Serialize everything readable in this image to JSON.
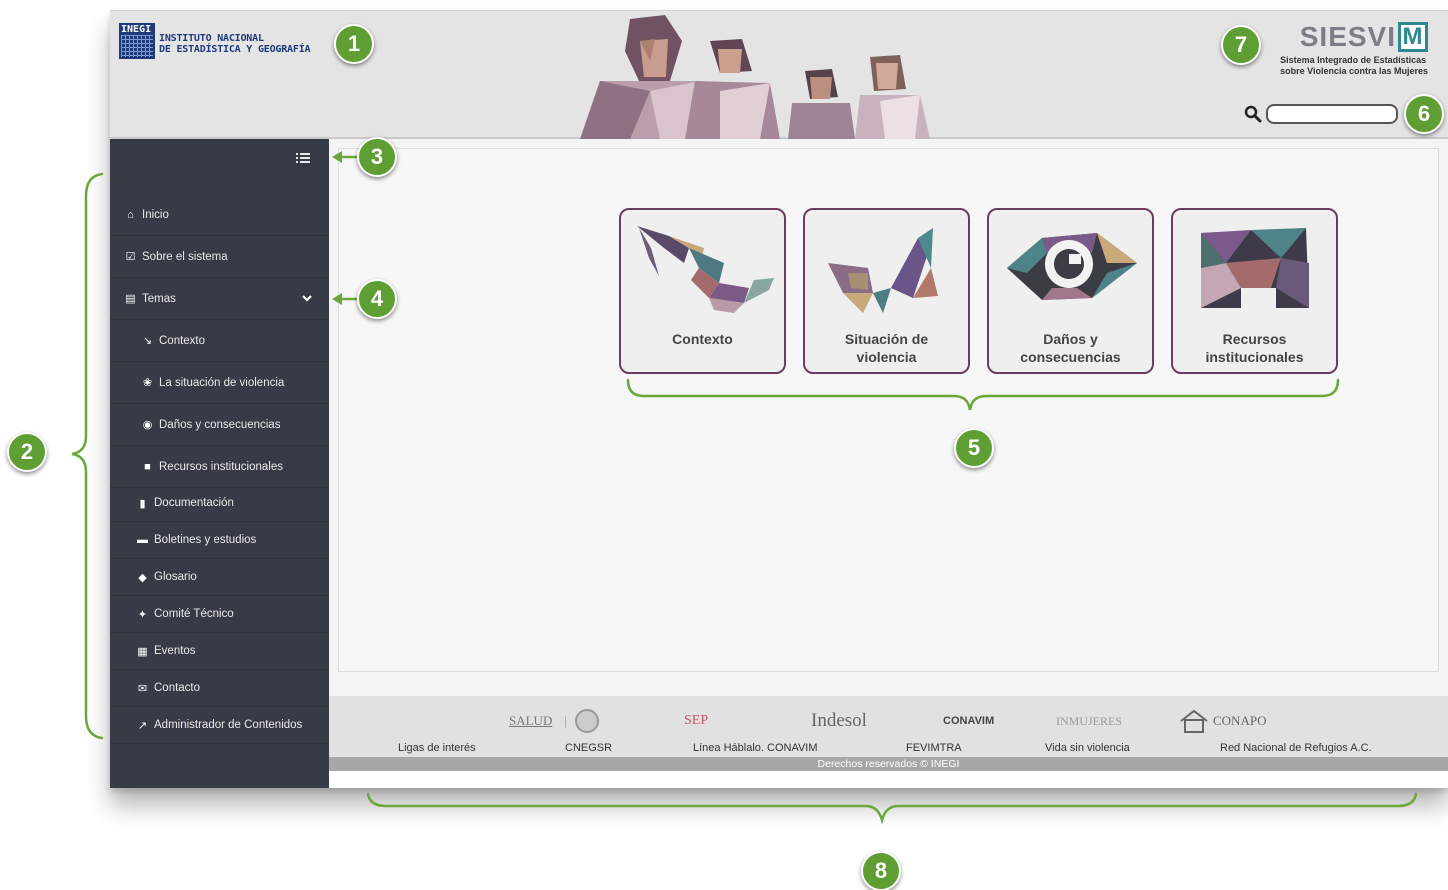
{
  "header": {
    "inegi_box": "INEGI",
    "inegi_line1": "INSTITUTO NACIONAL",
    "inegi_line2": "DE ESTADÍSTICA Y GEOGRAFÍA",
    "siesvim_word": "SIESVI",
    "siesvim_m": "M",
    "siesvim_sub1": "Sistema Integrado de Estadísticas",
    "siesvim_sub2": "sobre Violencia contra las Mujeres",
    "search_value": ""
  },
  "sidebar": {
    "items": [
      {
        "icon": "home-icon",
        "glyph": "⌂",
        "label": "Inicio"
      },
      {
        "icon": "checkbox-icon",
        "glyph": "☑",
        "label": "Sobre el sistema"
      },
      {
        "icon": "monitor-icon",
        "glyph": "▤",
        "label": "Temas"
      },
      {
        "icon": "map-icon",
        "glyph": "↘",
        "label": "Contexto"
      },
      {
        "icon": "butterfly-icon",
        "glyph": "❀",
        "label": "La situación de violencia"
      },
      {
        "icon": "eye-icon",
        "glyph": "◉",
        "label": "Daños y consecuencias"
      },
      {
        "icon": "building-icon",
        "glyph": "■",
        "label": "Recursos institucionales"
      },
      {
        "icon": "document-icon",
        "glyph": "▮",
        "label": "Documentación"
      },
      {
        "icon": "newspaper-icon",
        "glyph": "▬",
        "label": "Boletines y estudios"
      },
      {
        "icon": "book-icon",
        "glyph": "◆",
        "label": "Glosario"
      },
      {
        "icon": "users-icon",
        "glyph": "✦",
        "label": "Comité Técnico"
      },
      {
        "icon": "calendar-icon",
        "glyph": "▦",
        "label": "Eventos"
      },
      {
        "icon": "envelope-icon",
        "glyph": "✉",
        "label": "Contacto"
      },
      {
        "icon": "wrench-icon",
        "glyph": "↗",
        "label": "Administrador de Contenidos"
      }
    ]
  },
  "cards": [
    {
      "line1": "Contexto",
      "line2": ""
    },
    {
      "line1": "Situación de",
      "line2": "violencia"
    },
    {
      "line1": "Daños y",
      "line2": "consecuencias"
    },
    {
      "line1": "Recursos",
      "line2": "institucionales"
    }
  ],
  "footer": {
    "logos": [
      "SALUD",
      "SEP",
      "Indesol",
      "CONAVIM",
      "INMUJERES",
      "CONAPO"
    ],
    "links": [
      "Ligas de interés",
      "CNEGSR",
      "Línea Háblalo. CONAVIM",
      "FEVIMTRA",
      "Vida sin violencia",
      "Red Nacional de Refugios A.C."
    ],
    "copyright": "Derechos reservados © INEGI"
  },
  "callouts": [
    "1",
    "2",
    "3",
    "4",
    "5",
    "6",
    "7",
    "8"
  ],
  "colors": {
    "sidebar": "#363b45",
    "card_border": "#6b3d5e",
    "callout": "#5e9e33",
    "siesvim_teal": "#2e8a8e"
  }
}
